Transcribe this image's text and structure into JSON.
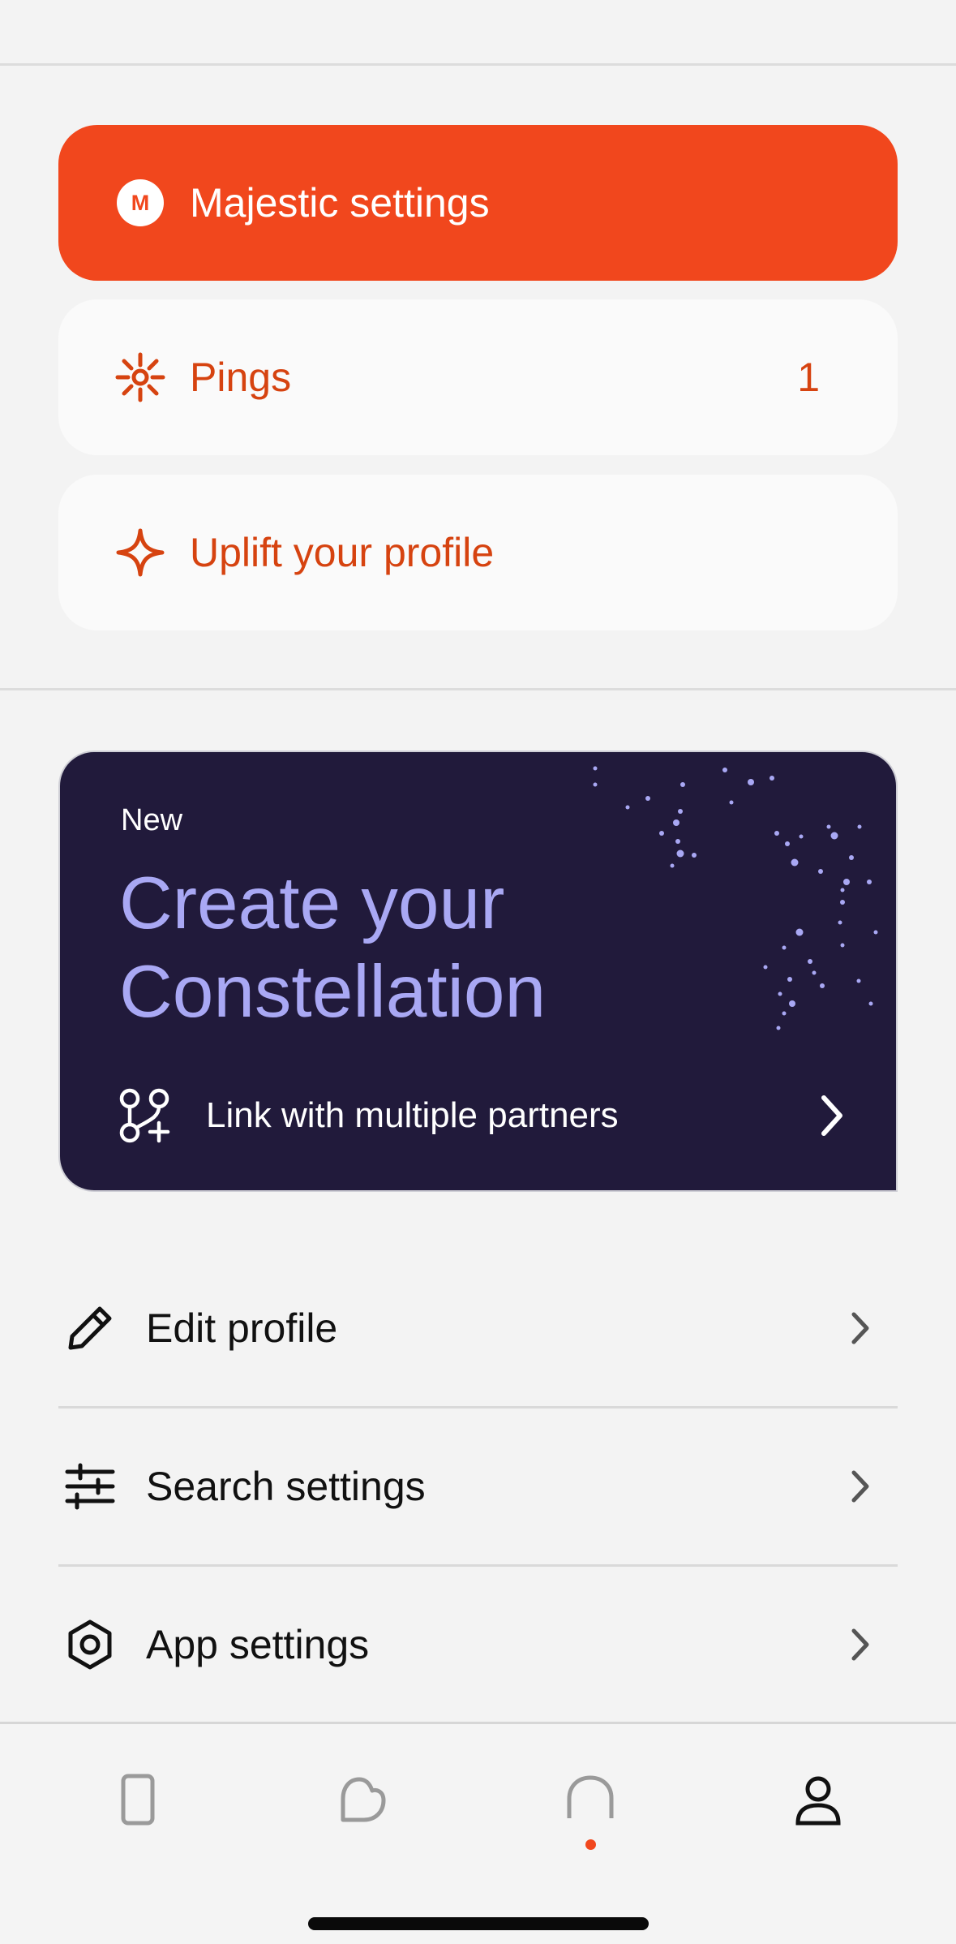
{
  "quick_actions": {
    "majestic": {
      "label": "Majestic settings",
      "badge_letter": "M",
      "icon": "majestic-badge-icon"
    },
    "pings": {
      "label": "Pings",
      "count": "1",
      "icon": "sparkle-burst-icon"
    },
    "uplift": {
      "label": "Uplift your profile",
      "icon": "four-point-star-icon"
    }
  },
  "promo": {
    "tag": "New",
    "headline": "Create your Constellation",
    "link_label": "Link with multiple partners",
    "icon": "link-partners-icon"
  },
  "menu": [
    {
      "label": "Edit profile",
      "icon": "pencil-icon"
    },
    {
      "label": "Search settings",
      "icon": "sliders-icon"
    },
    {
      "label": "App settings",
      "icon": "hexagon-settings-icon"
    }
  ],
  "tab_bar": [
    {
      "name": "phone",
      "icon": "phone-icon"
    },
    {
      "name": "likes",
      "icon": "likes-icon"
    },
    {
      "name": "chat",
      "icon": "chat-icon",
      "has_notification": true
    },
    {
      "name": "profile",
      "icon": "profile-icon",
      "selected": true
    }
  ],
  "colors": {
    "accent": "#f1471d",
    "accent_text": "#d64310",
    "promo_background": "#211a3b",
    "promo_headline": "#a9a8f4",
    "page_background": "#f3f3f3"
  }
}
